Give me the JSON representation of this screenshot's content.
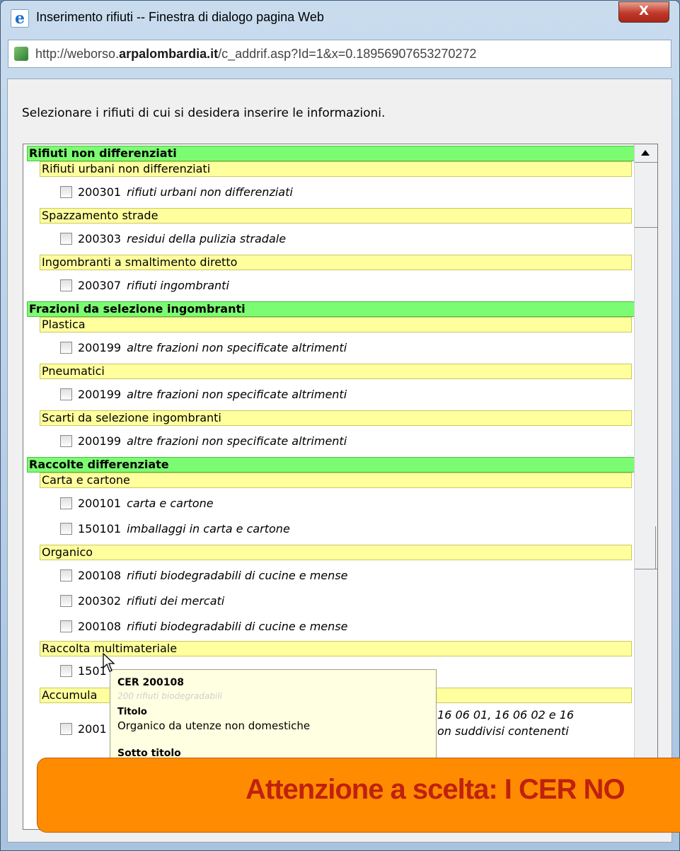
{
  "window": {
    "title": "Inserimento rifiuti -- Finestra di dialogo pagina Web",
    "close_label": "X",
    "url_prefix": "http://weborso.",
    "url_domain": "arpalombardia.it",
    "url_suffix": "/c_addrif.asp?Id=1&x=0.18956907653270272"
  },
  "instruction": "Selezionare i rifiuti di cui si desidera inserire le informazioni.",
  "list": {
    "cat1": "Rifiuti non differenziati",
    "sub1": "Rifiuti urbani non differenziati",
    "i1": {
      "code": "200301",
      "desc": "rifiuti urbani non differenziati"
    },
    "sub2": "Spazzamento strade",
    "i2": {
      "code": "200303",
      "desc": "residui della pulizia stradale"
    },
    "sub3": "Ingombranti a smaltimento diretto",
    "i3": {
      "code": "200307",
      "desc": "rifiuti ingombranti"
    },
    "cat2": "Frazioni da selezione ingombranti",
    "sub4": "Plastica",
    "i4": {
      "code": "200199",
      "desc": "altre frazioni non specificate altrimenti"
    },
    "sub5": "Pneumatici",
    "i5": {
      "code": "200199",
      "desc": "altre frazioni non specificate altrimenti"
    },
    "sub6": "Scarti da selezione ingombranti",
    "i6": {
      "code": "200199",
      "desc": "altre frazioni non specificate altrimenti"
    },
    "cat3": "Raccolte differenziate",
    "sub7": "Carta e cartone",
    "i7": {
      "code": "200101",
      "desc": "carta e cartone"
    },
    "i8": {
      "code": "150101",
      "desc": "imballaggi in carta e cartone"
    },
    "sub8": "Organico",
    "i9": {
      "code": "200108",
      "desc": "rifiuti biodegradabili di cucine e mense"
    },
    "i10": {
      "code": "200302",
      "desc": "rifiuti dei mercati"
    },
    "i11": {
      "code": "200108",
      "desc": "rifiuti biodegradabili di cucine e mense"
    },
    "sub9": "Raccolta multimateriale",
    "i12": {
      "code": "1501"
    },
    "sub10": "Accumula",
    "i13_tail": "16 06 01, 16 06 02 e 16",
    "i13_code": "2001",
    "i14_tail": "on suddivisi contenenti"
  },
  "tooltip": {
    "cer": "CER 200108",
    "titolo_label": "Titolo",
    "titolo": "Organico da utenze non domestiche",
    "sotto_label": "Sotto titolo"
  },
  "banner": {
    "text": "Attenzione a scelta: I CER NO",
    "color": "#ff8c00",
    "text_color": "#c0210e"
  }
}
